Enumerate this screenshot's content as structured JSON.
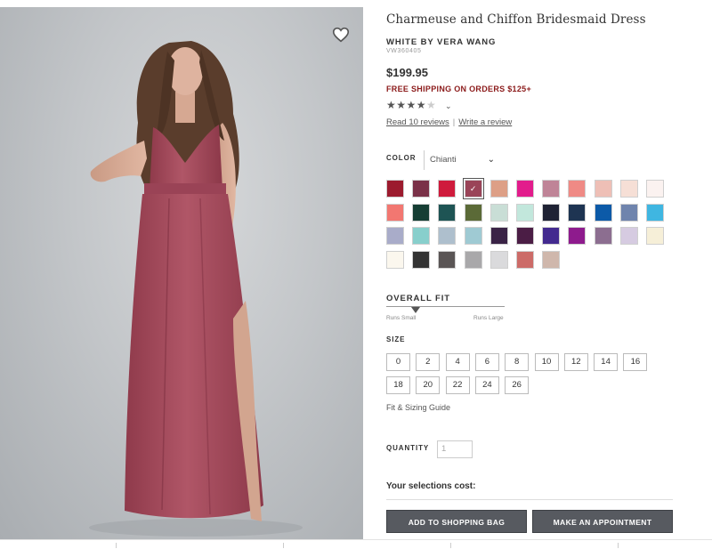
{
  "product": {
    "title": "Charmeuse and Chiffon Bridesmaid Dress",
    "brand": "WHITE BY VERA WANG",
    "sku": "VW360405",
    "price": "$199.95",
    "shipping_promo": "FREE SHIPPING ON ORDERS $125+",
    "rating_stars_filled": "★★★★",
    "rating_stars_empty": "★",
    "rating": 4,
    "rating_max": 5,
    "read_reviews": "Read 10 reviews",
    "write_review": "Write a review"
  },
  "color": {
    "label": "COLOR",
    "selected": "Chianti",
    "swatch_rows": [
      [
        "#9c1b2e",
        "#7a3148",
        "#cf1b3c",
        "#9a4458",
        "#dd9f86",
        "#e21c8c",
        "#bf8497",
        "#ef8a85",
        "#eebfb6",
        "#f6dfd6",
        "#fbf2f0"
      ],
      [
        "#f27771",
        "#163e34",
        "#1e5454",
        "#5b6a37",
        "#c9ded6",
        "#c2e7dc",
        "#1f2234",
        "#1e3452",
        "#0c5aa8",
        "#6f84ad",
        "#3fb6e1"
      ],
      [
        "#a9acc9",
        "#88cfcc",
        "#aebfcd",
        "#9fcad3",
        "#3a2346",
        "#4b1d45",
        "#432a8f",
        "#8e1b8d",
        "#8c6e90",
        "#d6cbe1",
        "#f6efd8"
      ],
      [
        "#fbf7ee",
        "#333333",
        "#5a5555",
        "#a9a8aa",
        "#dadadc",
        "#cc6b68",
        "#cfb7ac"
      ]
    ],
    "selected_index": [
      0,
      3
    ]
  },
  "fit": {
    "label": "OVERALL FIT",
    "min_label": "Runs Small",
    "max_label": "Runs Large",
    "value": 0.25
  },
  "size": {
    "label": "SIZE",
    "rows": [
      [
        "0",
        "2",
        "4",
        "6",
        "8",
        "10",
        "12",
        "14",
        "16"
      ],
      [
        "18",
        "20",
        "22",
        "24",
        "26"
      ]
    ],
    "guide": "Fit & Sizing Guide"
  },
  "quantity": {
    "label": "QUANTITY",
    "value": "1"
  },
  "summary": {
    "cost_label": "Your selections cost:"
  },
  "actions": {
    "add_to_bag": "ADD TO SHOPPING BAG",
    "appointment": "MAKE AN APPOINTMENT"
  },
  "colors": {
    "dress": "#a84b5c",
    "button": "#575a60",
    "promo": "#8b1a1a"
  },
  "icons": {
    "favorite": "heart-icon",
    "dropdown": "chevron-down-icon"
  }
}
